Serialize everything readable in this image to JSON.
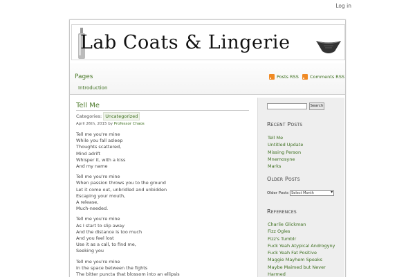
{
  "header": {
    "login": "Log in"
  },
  "banner": {
    "title": "Lab Coats & Lingerie"
  },
  "nav": {
    "pages_heading": "Pages",
    "pages": [
      "Introduction"
    ],
    "posts_rss": "Posts RSS",
    "comments_rss": "Comments RSS"
  },
  "post": {
    "title": "Tell Me",
    "categories_label": "Categories:",
    "category": "Uncategorized",
    "date": "April 26th, 2015",
    "by": "by",
    "author": "Professor Chaos",
    "stanzas": [
      [
        "Tell me you're mine",
        "While you fall asleep",
        "Thoughts scattered,",
        "Mind adrift",
        "Whisper it, with a kiss",
        "And my name"
      ],
      [
        "Tell me you're mine",
        "When passion throws you to the ground",
        "Let it come out, unbridled and unbidden",
        "Escaping your mouth,",
        "A release,",
        "Much-needed."
      ],
      [
        "Tell me you're mine",
        "As I start to slip away",
        "And the distance is too much",
        "And you feel lost",
        "Use it as a call, to find me,",
        "Seeking you"
      ],
      [
        "Tell me you're mine",
        "In the space between the fights",
        "The bitter puncta that blossom into an ellipsis"
      ]
    ]
  },
  "sidebar": {
    "search_button": "Search",
    "recent_heading": "Recent Posts",
    "recent": [
      "Tell Me",
      "Untitled Update",
      "Missing Person",
      "Mnemosyne",
      "Marks"
    ],
    "older_heading": "Older Posts",
    "older_label": "Older Posts",
    "archive_select": "Select Month",
    "references_heading": "References",
    "references": [
      "Charlie Glickman",
      "Fizz Ogles",
      "Fizz's Tumblr",
      "Fuck Yeah Atypical Androgyny",
      "Fuck Yeah Fat Positive",
      "Maggie Mayhem Speaks",
      "Maybe Maimed but Never",
      "Harmed"
    ]
  }
}
